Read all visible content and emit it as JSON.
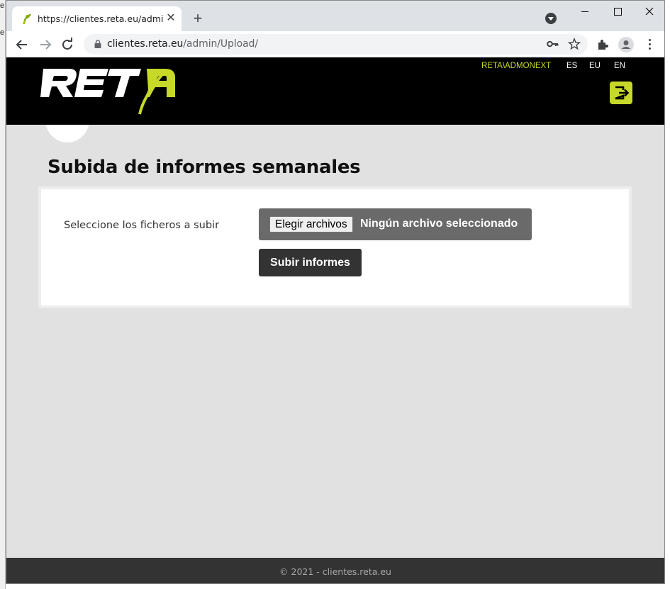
{
  "background_window": {
    "glyphs": [
      "e",
      "e"
    ]
  },
  "browser": {
    "tab": {
      "title": "https://clientes.reta.eu/admin/Upload/",
      "close_symbol": "✕"
    },
    "new_tab_symbol": "+",
    "url": {
      "host": "clientes.reta.eu",
      "path": "/admin/Upload/"
    },
    "icons": [
      "favicon-icon",
      "tab-search-icon",
      "back-icon",
      "forward-icon",
      "reload-icon",
      "lock-icon",
      "key-icon",
      "star-icon",
      "extensions-icon",
      "profile-icon",
      "menu-icon"
    ],
    "window_controls": [
      "minimize",
      "maximize",
      "close"
    ]
  },
  "header": {
    "brand": "RETA",
    "brand_accent": "#c6d82a",
    "user": "RETA\\ADMONEXT",
    "languages": [
      "ES",
      "EU",
      "EN"
    ],
    "logout_icon": "logout-icon"
  },
  "main": {
    "title": "Subida de informes semanales",
    "file_label": "Seleccione los ficheros a subir",
    "file_choose": "Elegir archivos",
    "file_status": "Ningún archivo seleccionado",
    "submit": "Subir informes"
  },
  "footer": {
    "text": "© 2021 - clientes.reta.eu"
  }
}
